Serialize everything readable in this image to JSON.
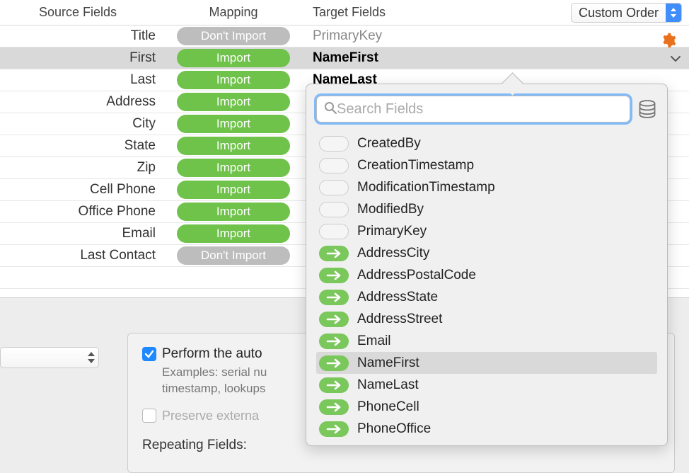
{
  "header": {
    "source_label": "Source Fields",
    "mapping_label": "Mapping",
    "target_label": "Target Fields",
    "order_select": "Custom Order"
  },
  "pill_labels": {
    "import": "Import",
    "dont_import": "Don't Import"
  },
  "rows": [
    {
      "source": "Title",
      "action": "dont_import",
      "target": "PrimaryKey",
      "selected": false,
      "bold": false
    },
    {
      "source": "First",
      "action": "import",
      "target": "NameFirst",
      "selected": true,
      "bold": true
    },
    {
      "source": "Last",
      "action": "import",
      "target": "NameLast",
      "selected": false,
      "bold": true
    },
    {
      "source": "Address",
      "action": "import",
      "target": "",
      "selected": false,
      "bold": false
    },
    {
      "source": "City",
      "action": "import",
      "target": "",
      "selected": false,
      "bold": false
    },
    {
      "source": "State",
      "action": "import",
      "target": "",
      "selected": false,
      "bold": false
    },
    {
      "source": "Zip",
      "action": "import",
      "target": "",
      "selected": false,
      "bold": false
    },
    {
      "source": "Cell Phone",
      "action": "import",
      "target": "",
      "selected": false,
      "bold": false
    },
    {
      "source": "Office Phone",
      "action": "import",
      "target": "",
      "selected": false,
      "bold": false
    },
    {
      "source": "Email",
      "action": "import",
      "target": "",
      "selected": false,
      "bold": false
    },
    {
      "source": "Last Contact",
      "action": "dont_import",
      "target": "",
      "selected": false,
      "bold": false
    }
  ],
  "popover": {
    "search_placeholder": "Search Fields",
    "items": [
      {
        "label": "CreatedBy",
        "used": false,
        "selected": false
      },
      {
        "label": "CreationTimestamp",
        "used": false,
        "selected": false
      },
      {
        "label": "ModificationTimestamp",
        "used": false,
        "selected": false
      },
      {
        "label": "ModifiedBy",
        "used": false,
        "selected": false
      },
      {
        "label": "PrimaryKey",
        "used": false,
        "selected": false
      },
      {
        "label": "AddressCity",
        "used": true,
        "selected": false
      },
      {
        "label": "AddressPostalCode",
        "used": true,
        "selected": false
      },
      {
        "label": "AddressState",
        "used": true,
        "selected": false
      },
      {
        "label": "AddressStreet",
        "used": true,
        "selected": false
      },
      {
        "label": "Email",
        "used": true,
        "selected": false
      },
      {
        "label": "NameFirst",
        "used": true,
        "selected": true
      },
      {
        "label": "NameLast",
        "used": true,
        "selected": false
      },
      {
        "label": "PhoneCell",
        "used": true,
        "selected": false
      },
      {
        "label": "PhoneOffice",
        "used": true,
        "selected": false
      }
    ]
  },
  "bottom": {
    "auto_enter_label": "Perform the auto",
    "examples_line1": "Examples: serial nu",
    "examples_line2": "timestamp, lookups",
    "preserve_label": "Preserve externa",
    "repeating_label": "Repeating Fields:"
  }
}
